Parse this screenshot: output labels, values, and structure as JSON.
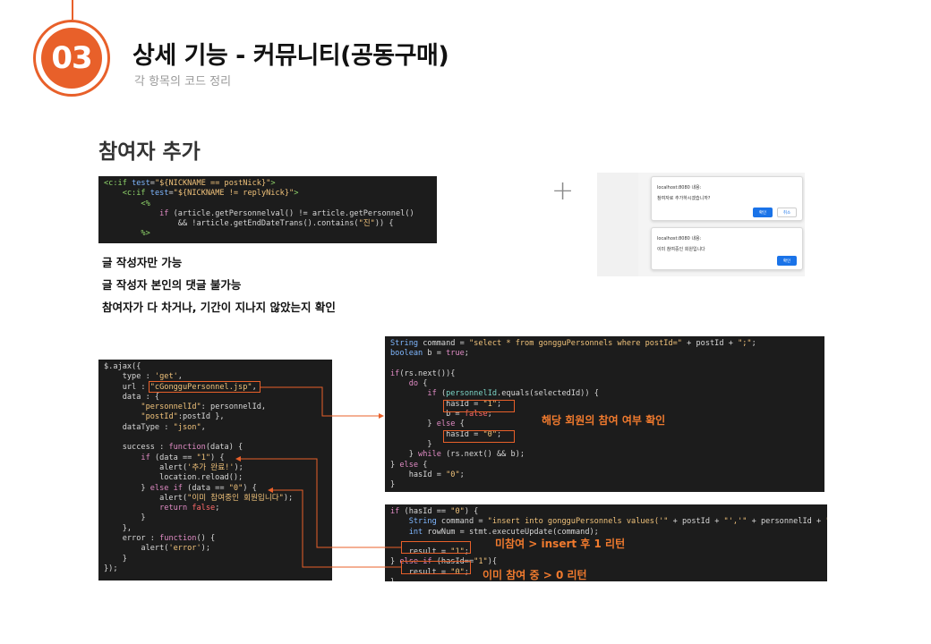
{
  "header": {
    "number": "03",
    "title": "상세 기능 - 커뮤니티(공동구매)",
    "subtitle": "각 항목의 코드 정리"
  },
  "section": {
    "title": "참여자 추가",
    "plus": "+"
  },
  "descriptions": [
    "글 작성자만 가능",
    "글 작성자 본인의 댓글 불가능",
    "참여자가 다 차거나, 기간이 지나지 않았는지 확인"
  ],
  "dialogs": {
    "first": {
      "host": "localhost:8080 내용:",
      "message": "참여자로 추가하시겠습니까?",
      "ok": "확인",
      "cancel": "취소"
    },
    "second": {
      "host": "localhost:8080 내용:",
      "message": "이미 참여중인 회원입니다",
      "ok": "확인"
    }
  },
  "notes": {
    "check": "해당 회원의 참여 여부 확인",
    "insert": "미참여 > insert 후 1 리턴",
    "already": "이미 참여 중 >  0 리턴"
  },
  "colors": {
    "accent": "#e8602a",
    "code_bg": "#1c1c1c"
  }
}
